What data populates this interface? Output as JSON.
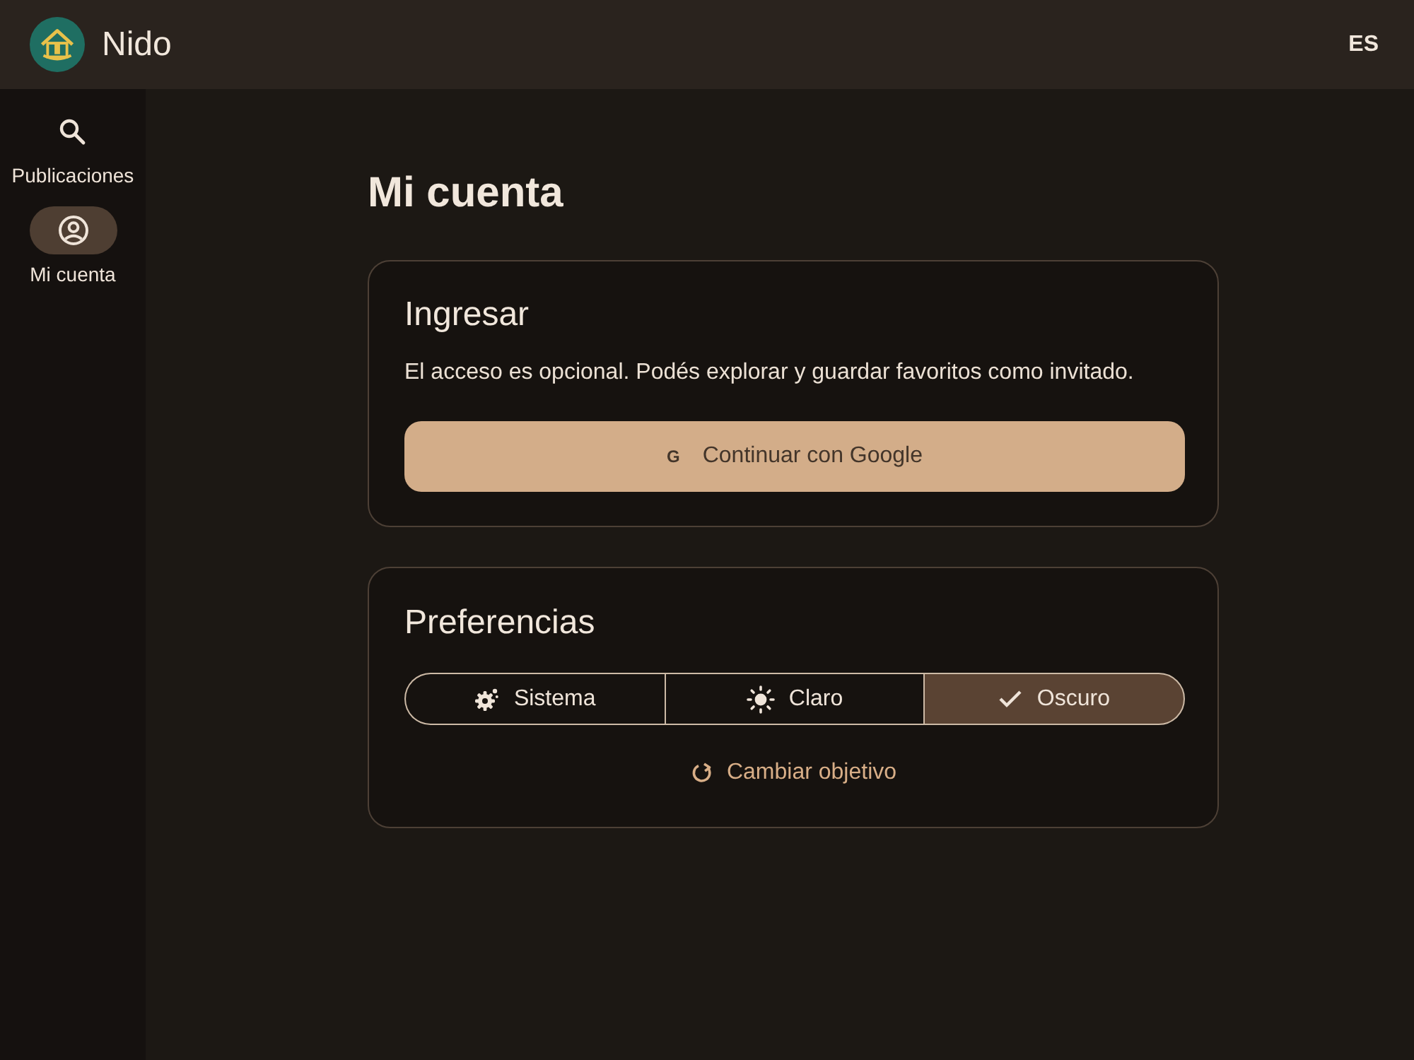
{
  "header": {
    "app_name": "Nido",
    "language": "ES"
  },
  "nav": [
    {
      "kind": "search",
      "label": "Publicaciones",
      "selected": false
    },
    {
      "kind": "account",
      "label": "Mi cuenta",
      "selected": true
    }
  ],
  "page_title": "Mi cuenta",
  "login_card": {
    "title": "Ingresar",
    "description": "El acceso es opcional. Podés explorar y guardar favoritos como invitado.",
    "button": {
      "icon_text": "G",
      "label": "Continuar con Google"
    }
  },
  "preferences_card": {
    "title": "Preferencias",
    "theme_options": [
      {
        "kind": "system",
        "label": "Sistema",
        "selected": false
      },
      {
        "kind": "light",
        "label": "Claro",
        "selected": false
      },
      {
        "label": "Oscuro",
        "selected": true
      }
    ],
    "link": {
      "label": "Cambiar objetivo"
    }
  }
}
